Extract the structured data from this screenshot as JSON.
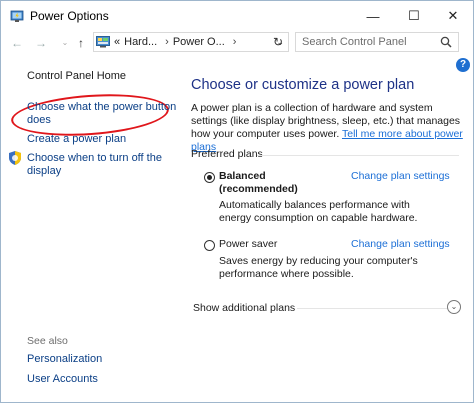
{
  "window": {
    "title": "Power Options"
  },
  "titlebar": {
    "minimize": "—",
    "maximize": "☐",
    "close": "✕"
  },
  "nav": {
    "back": "←",
    "forward": "→",
    "up": "↑",
    "breadcrumb_prefix": "«",
    "crumbs": [
      "Hard...",
      "Power O..."
    ],
    "crumb_sep": "›",
    "dropdown": "⌄",
    "refresh": "↻",
    "search_placeholder": "Search Control Panel"
  },
  "help": {
    "label": "?"
  },
  "sidebar": {
    "home": "Control Panel Home",
    "power_button_line1": "Choose what the power button",
    "power_button_line2": "does",
    "create_plan": "Create a power plan",
    "turn_off_line1": "Choose when to turn off the",
    "turn_off_line2": "display",
    "see_also": "See also",
    "personalization": "Personalization",
    "user_accounts": "User Accounts"
  },
  "main": {
    "heading": "Choose or customize a power plan",
    "intro_text": "A power plan is a collection of hardware and system settings (like display brightness, sleep, etc.) that manages how your computer uses power.",
    "intro_link": "Tell me more about power plans",
    "preferred_plans": "Preferred plans",
    "plans": [
      {
        "name": "Balanced",
        "note": "(recommended)",
        "selected": true,
        "change_label": "Change plan settings",
        "description": "Automatically balances performance with energy consumption on capable hardware."
      },
      {
        "name": "Power saver",
        "selected": false,
        "change_label": "Change plan settings",
        "description": "Saves energy by reducing your computer's performance where possible."
      }
    ],
    "show_additional": "Show additional plans",
    "expand_icon": "⌄"
  },
  "colors": {
    "heading": "#1e3287",
    "link": "#1c6fd6",
    "nav_link": "#0b3f86",
    "annotation": "#e0161b",
    "help": "#1f6fd0"
  },
  "icons": [
    "power-options-icon",
    "control-panel-icon",
    "search-icon",
    "shield-icon"
  ]
}
